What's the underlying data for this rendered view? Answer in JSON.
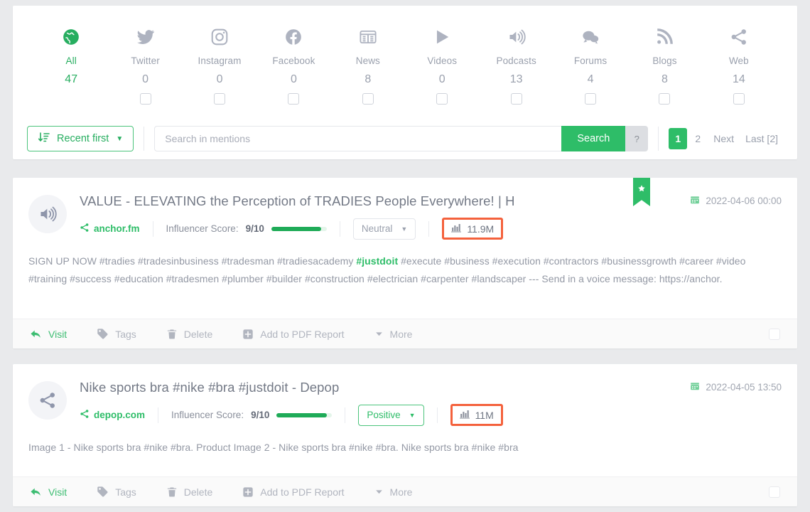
{
  "source_tabs": [
    {
      "label": "All",
      "count": "47",
      "icon": "globe-icon",
      "active": true,
      "has_checkbox": false
    },
    {
      "label": "Twitter",
      "count": "0",
      "icon": "twitter-icon",
      "active": false,
      "has_checkbox": true
    },
    {
      "label": "Instagram",
      "count": "0",
      "icon": "instagram-icon",
      "active": false,
      "has_checkbox": true
    },
    {
      "label": "Facebook",
      "count": "0",
      "icon": "facebook-icon",
      "active": false,
      "has_checkbox": true
    },
    {
      "label": "News",
      "count": "8",
      "icon": "news-icon",
      "active": false,
      "has_checkbox": true
    },
    {
      "label": "Videos",
      "count": "0",
      "icon": "play-icon",
      "active": false,
      "has_checkbox": true
    },
    {
      "label": "Podcasts",
      "count": "13",
      "icon": "speaker-icon",
      "active": false,
      "has_checkbox": true
    },
    {
      "label": "Forums",
      "count": "4",
      "icon": "chat-icon",
      "active": false,
      "has_checkbox": true
    },
    {
      "label": "Blogs",
      "count": "8",
      "icon": "rss-icon",
      "active": false,
      "has_checkbox": true
    },
    {
      "label": "Web",
      "count": "14",
      "icon": "share-icon",
      "active": false,
      "has_checkbox": true
    }
  ],
  "toolbar": {
    "sort_label": "Recent first",
    "sort_icon": "sort-descending-icon",
    "search_placeholder": "Search in mentions",
    "search_value": "",
    "search_button": "Search",
    "help_button": "?"
  },
  "pagination": {
    "pages": [
      {
        "label": "1",
        "current": true
      },
      {
        "label": "2",
        "current": false
      }
    ],
    "next": "Next",
    "last": "Last [2]"
  },
  "mentions": [
    {
      "avatar_icon": "speaker-icon",
      "title": "VALUE - ELEVATING the Perception of TRADIES People Everywhere! | H",
      "domain": "anchor.fm",
      "domain_icon": "share-icon",
      "influencer_label": "Influencer Score:",
      "influencer_score": "9/10",
      "sentiment": "Neutral",
      "sentiment_kind": "neutral",
      "reach": "11.9M",
      "reach_icon": "bar-chart-icon",
      "date": "2022-04-06 00:00",
      "date_icon": "calendar-icon",
      "bookmarked": true,
      "bookmark_icon": "star-ribbon-icon",
      "snippet_parts": [
        {
          "text": "SIGN UP NOW #tradies #tradesinbusiness #tradesman #tradiesacademy ",
          "highlight": false
        },
        {
          "text": "#justdoit",
          "highlight": true
        },
        {
          "text": " #execute #business #execution #contractors #businessgrowth #career #video #training #success #education #tradesmen #plumber #builder #construction #electrician #carpenter #landscaper --- Send in a voice message: https://anchor.",
          "highlight": false
        }
      ]
    },
    {
      "avatar_icon": "share-icon",
      "title": "Nike sports bra #nike #bra #justdoit - Depop",
      "domain": "depop.com",
      "domain_icon": "share-icon",
      "influencer_label": "Influencer Score:",
      "influencer_score": "9/10",
      "sentiment": "Positive",
      "sentiment_kind": "positive",
      "reach": "11M",
      "reach_icon": "bar-chart-icon",
      "date": "2022-04-05 13:50",
      "date_icon": "calendar-icon",
      "bookmarked": false,
      "bookmark_icon": "star-ribbon-icon",
      "snippet_parts": [
        {
          "text": "Image 1 - Nike sports bra #nike #bra. Product Image 2 - Nike sports bra #nike #bra. Nike sports bra #nike #bra",
          "highlight": false
        }
      ]
    }
  ],
  "card_actions": [
    {
      "label": "Visit",
      "icon": "reply-arrow-icon",
      "kind": "visit"
    },
    {
      "label": "Tags",
      "icon": "tag-icon",
      "kind": "tags"
    },
    {
      "label": "Delete",
      "icon": "trash-icon",
      "kind": "delete"
    },
    {
      "label": "Add to PDF Report",
      "icon": "plus-square-icon",
      "kind": "pdf"
    },
    {
      "label": "More",
      "icon": "caret-down-icon",
      "kind": "more"
    }
  ],
  "colors": {
    "accent_green": "#2ebd68",
    "reach_highlight": "#f4613c",
    "muted_text": "#9aa0ad",
    "page_bg": "#e9eaec"
  }
}
